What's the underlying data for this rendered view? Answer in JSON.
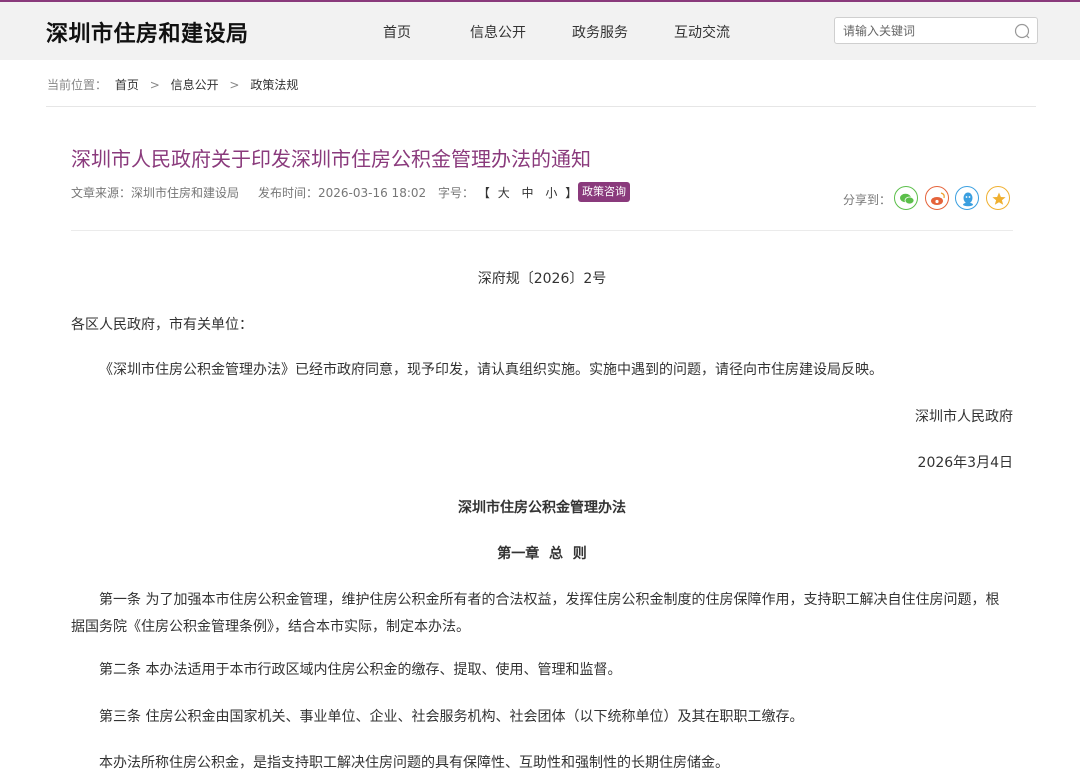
{
  "header": {
    "site_title": "深圳市住房和建设局",
    "nav": [
      "首页",
      "信息公开",
      "政务服务",
      "互动交流"
    ],
    "search_placeholder": "请输入关键词"
  },
  "breadcrumb": {
    "label": "当前位置：",
    "items": [
      "首页",
      "信息公开",
      "政策法规"
    ],
    "separator": ">"
  },
  "article": {
    "title": "深圳市人民政府关于印发深圳市住房公积金管理办法的通知",
    "source": "文章来源：深圳市住房和建设局",
    "publish_time": "发布时间：2026-03-16 18:02",
    "font_size_label": "字号：",
    "font_size_open": "【",
    "font_sizes": [
      "大",
      "中",
      "小"
    ],
    "font_size_close": "】",
    "tag": "政策咨询",
    "share_label": "分享到：",
    "share_icons": [
      "wechat-icon",
      "weibo-icon",
      "qq-icon",
      "favorite-icon"
    ],
    "doc_number": "深府规〔2026〕2号",
    "salutation": "各区人民政府，市有关单位：",
    "notice": "《深圳市住房公积金管理办法》已经市政府同意，现予印发，请认真组织实施。实施中遇到的问题，请径向市住房建设局反映。",
    "issuer": "深圳市人民政府",
    "date": "2026年3月4日",
    "doc_title": "深圳市住房公积金管理办法",
    "chapter": "第一章  总  则",
    "articles": [
      "第一条  为了加强本市住房公积金管理，维护住房公积金所有者的合法权益，发挥住房公积金制度的住房保障作用，支持职工解决自住住房问题，根据国务院《住房公积金管理条例》，结合本市实际，制定本办法。",
      "第二条  本办法适用于本市行政区域内住房公积金的缴存、提取、使用、管理和监督。",
      "第三条  住房公积金由国家机关、事业单位、企业、社会服务机构、社会团体（以下统称单位）及其在职职工缴存。",
      "本办法所称住房公积金，是指支持职工解决住房问题的具有保障性、互助性和强制性的长期住房储金。"
    ]
  },
  "colors": {
    "accent": "#8a3a7c",
    "header_bg": "#f2f2f2"
  }
}
